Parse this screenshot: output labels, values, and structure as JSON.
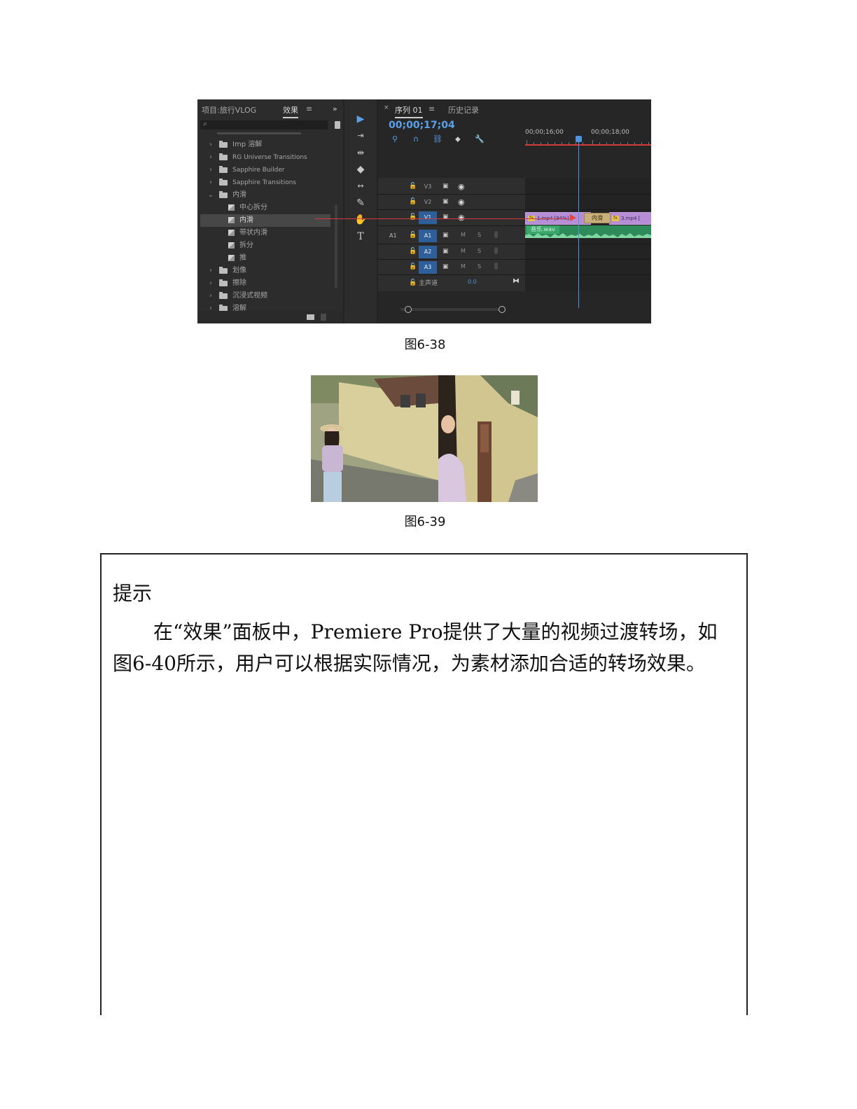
{
  "figure_6_38": {
    "effects_panel": {
      "project_tab": "项目:旅行VLOG",
      "effects_tab": "效果",
      "menu_glyph": "≡",
      "overflow_glyph": "»",
      "tree": [
        {
          "label": "Imp 溶解",
          "type": "folder",
          "expanded": false
        },
        {
          "label": "RG Universe Transitions",
          "type": "folder",
          "expanded": false
        },
        {
          "label": "Sapphire Builder",
          "type": "folder",
          "expanded": false
        },
        {
          "label": "Sapphire Transitions",
          "type": "folder",
          "expanded": false
        },
        {
          "label": "内滑",
          "type": "folder",
          "expanded": true
        },
        {
          "label": "中心拆分",
          "type": "effect"
        },
        {
          "label": "内滑",
          "type": "effect",
          "selected": true
        },
        {
          "label": "带状内滑",
          "type": "effect"
        },
        {
          "label": "拆分",
          "type": "effect"
        },
        {
          "label": "推",
          "type": "effect"
        },
        {
          "label": "划像",
          "type": "folder",
          "expanded": false
        },
        {
          "label": "擦除",
          "type": "folder",
          "expanded": false
        },
        {
          "label": "沉浸式视频",
          "type": "folder",
          "expanded": false
        },
        {
          "label": "溶解",
          "type": "folder",
          "expanded": false
        }
      ]
    },
    "tools": [
      "selection-tool",
      "track-select-tool",
      "ripple-edit-tool",
      "razor-tool",
      "slip-tool",
      "pen-tool",
      "hand-tool",
      "type-tool"
    ],
    "timeline": {
      "close_glyph": "×",
      "sequence_tab": "序列 01",
      "menu_glyph": "≡",
      "history_tab": "历史记录",
      "timecode": "00;00;17;04",
      "ruler_labels": [
        "00;00;16;00",
        "00;00;18;00"
      ],
      "video_tracks": [
        "V3",
        "V2",
        "V1"
      ],
      "audio_tracks": [
        "A1",
        "A2",
        "A3"
      ],
      "source_patch": "A1",
      "mute_label": "M",
      "solo_label": "S",
      "master_label": "主声道",
      "master_value": "0.0",
      "clips": {
        "clip1": "1.mp4 [94%]",
        "transition": "内滑",
        "clip2": "3.mp4 [",
        "audio": "音乐.wav"
      }
    },
    "caption": "图6-38"
  },
  "figure_6_39": {
    "caption": "图6-39"
  },
  "tip": {
    "title": "提示",
    "body": "在“效果”面板中，Premiere Pro提供了大量的视频过渡转场，如图6-40所示，用户可以根据实际情况，为素材添加合适的转场效果。"
  }
}
